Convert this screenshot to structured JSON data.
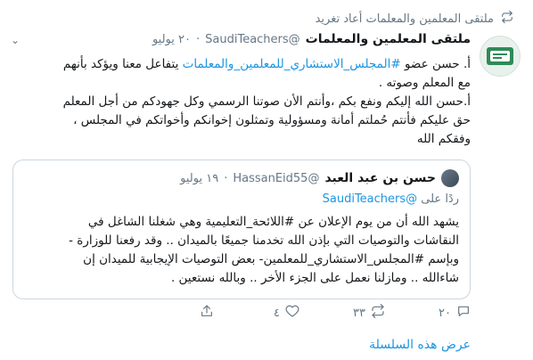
{
  "retweet": {
    "text": "ملتقى المعلمين والمعلمات أعاد تغريد",
    "icon": "retweet-icon"
  },
  "tweet": {
    "name": "ملتقى المعلمين والمعلمات",
    "handle": "@SaudiTeachers",
    "dot": "·",
    "date": "٢٠ يوليو",
    "caret": "⌄",
    "line1_prefix": "أ. حسن عضو ",
    "line1_hashtag": "#المجلس_الاستشاري_للمعلمين_والمعلمات",
    "line1_suffix": " يتفاعل معنا ويؤكد بأنهم",
    "line2": "مع المعلم وصوته .",
    "line3": "أ.حسن الله إليكم ونفع بكم ،وأنتم الأن صوتنا الرسمي وكل جهودكم من أجل المعلم",
    "line4": "حق عليكم فأنتم حُملتم أمانة ومسؤولية وتمثلون إخوانكم وأخواتكم في المجلس ،",
    "line5": "وفقكم الله"
  },
  "quote": {
    "name": "حسن بن عبد العبد",
    "handle": "@HassanEid55",
    "dot": "·",
    "date": "١٩ يوليو",
    "reply_prefix": "ردًا على ",
    "reply_handle": "@SaudiTeachers",
    "line1": "يشهد الله أن من يوم الإعلان عن #اللائحة_التعليمية وهي شغلنا الشاغل في",
    "line2": "النقاشات والتوصيات التي بإذن الله تخدمنا جميعًا  بالميدان .. وقد رفعنا للوزارة -",
    "line3": "وبإسم #المجلس_الاستشاري_للمعلمين- بعض التوصيات الإيجابية للميدان إن",
    "line4": "شاءالله .. ومازلنا نعمل على الجزء الأخر .. وبالله نستعين ."
  },
  "actions": {
    "reply_count": "٢٠",
    "retweet_count": "٣٣",
    "like_count": "٤"
  },
  "show_thread": "عرض هذه السلسلة",
  "colors": {
    "link": "#1b95e0",
    "muted": "#657786",
    "border": "#ccd6dd"
  }
}
